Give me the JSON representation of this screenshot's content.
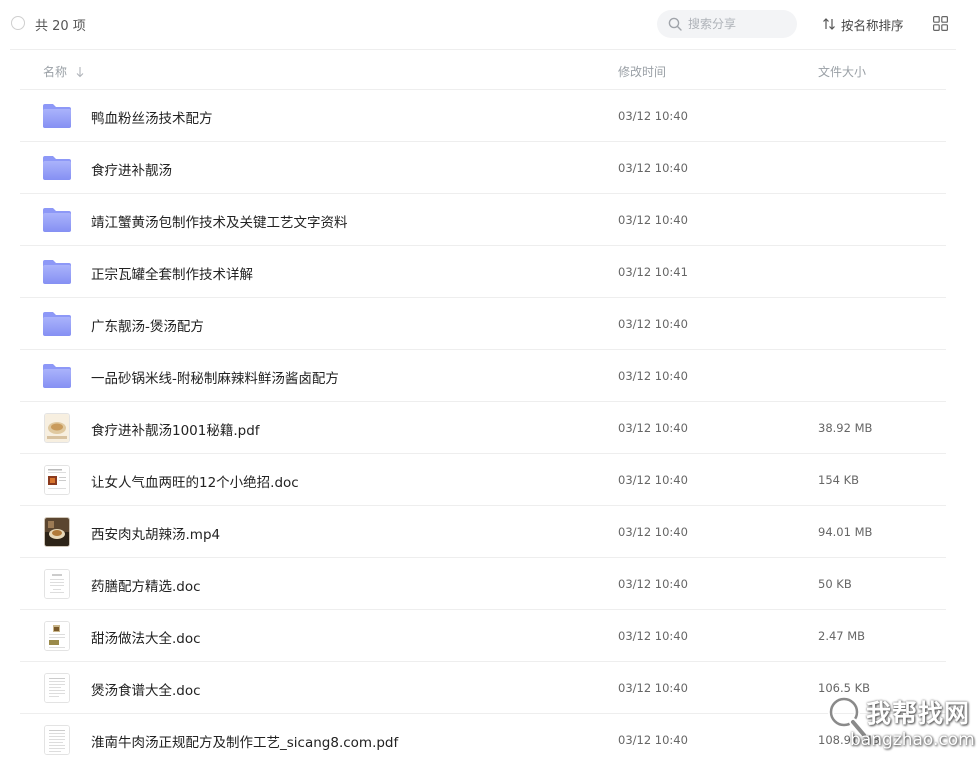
{
  "toolbar": {
    "count_label": "共 20 项",
    "search_placeholder": "搜索分享",
    "sort_label": "按名称排序"
  },
  "table": {
    "columns": {
      "name": "名称",
      "modified": "修改时间",
      "size": "文件大小"
    },
    "rows": [
      {
        "name": "鸭血粉丝汤技术配方",
        "modified": "03/12 10:40",
        "size": "",
        "type": "folder"
      },
      {
        "name": "食疗进补靓汤",
        "modified": "03/12 10:40",
        "size": "",
        "type": "folder"
      },
      {
        "name": "靖江蟹黄汤包制作技术及关键工艺文字资料",
        "modified": "03/12 10:40",
        "size": "",
        "type": "folder"
      },
      {
        "name": "正宗瓦罐全套制作技术详解",
        "modified": "03/12 10:41",
        "size": "",
        "type": "folder"
      },
      {
        "name": "广东靓汤-煲汤配方",
        "modified": "03/12 10:40",
        "size": "",
        "type": "folder"
      },
      {
        "name": "一品砂锅米线-附秘制麻辣料鲜汤酱卤配方",
        "modified": "03/12 10:40",
        "size": "",
        "type": "folder"
      },
      {
        "name": "食疗进补靓汤1001秘籍.pdf",
        "modified": "03/12 10:40",
        "size": "38.92 MB",
        "type": "pdf-thumb"
      },
      {
        "name": "让女人气血两旺的12个小绝招.doc",
        "modified": "03/12 10:40",
        "size": "154 KB",
        "type": "doc-thumb-red"
      },
      {
        "name": "西安肉丸胡辣汤.mp4",
        "modified": "03/12 10:40",
        "size": "94.01 MB",
        "type": "video-thumb"
      },
      {
        "name": "药膳配方精选.doc",
        "modified": "03/12 10:40",
        "size": "50 KB",
        "type": "doc-thumb-plain"
      },
      {
        "name": "甜汤做法大全.doc",
        "modified": "03/12 10:40",
        "size": "2.47 MB",
        "type": "doc-thumb-img"
      },
      {
        "name": "煲汤食谱大全.doc",
        "modified": "03/12 10:40",
        "size": "106.5 KB",
        "type": "doc-thumb-text"
      },
      {
        "name": "淮南牛肉汤正规配方及制作工艺_sicang8.com.pdf",
        "modified": "03/12 10:40",
        "size": "108.91 MB",
        "type": "pdf-thumb-text"
      }
    ]
  },
  "watermark": {
    "title": "我帮找网",
    "url": "bangzhao.com"
  },
  "colors": {
    "folder": "#7b86f5",
    "folder_light": "#a7b0fb",
    "separator": "#eeeeee"
  }
}
